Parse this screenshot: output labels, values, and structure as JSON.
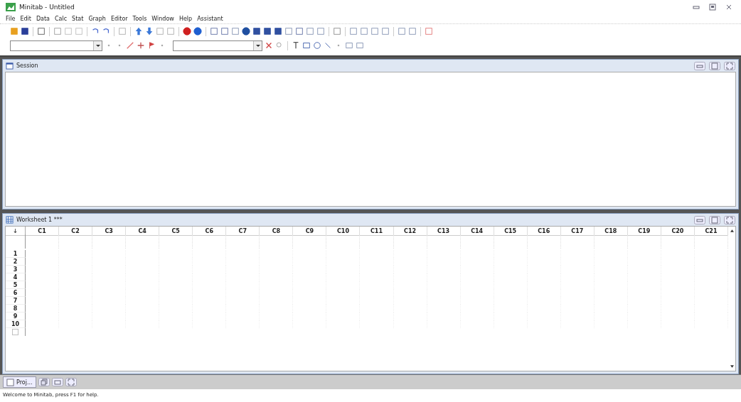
{
  "window": {
    "title": "Minitab - Untitled"
  },
  "menu": [
    "File",
    "Edit",
    "Data",
    "Calc",
    "Stat",
    "Graph",
    "Editor",
    "Tools",
    "Window",
    "Help",
    "Assistant"
  ],
  "session": {
    "title": "Session"
  },
  "worksheet": {
    "title": "Worksheet 1 ***",
    "columns": [
      "C1",
      "C2",
      "C3",
      "C4",
      "C5",
      "C6",
      "C7",
      "C8",
      "C9",
      "C10",
      "C11",
      "C12",
      "C13",
      "C14",
      "C15",
      "C16",
      "C17",
      "C18",
      "C19",
      "C20",
      "C21"
    ],
    "rows": [
      "1",
      "2",
      "3",
      "4",
      "5",
      "6",
      "7",
      "8",
      "9",
      "10"
    ]
  },
  "project_tab": {
    "label": "Proj..."
  },
  "status_bar": "Welcome to Minitab, press F1 for help."
}
